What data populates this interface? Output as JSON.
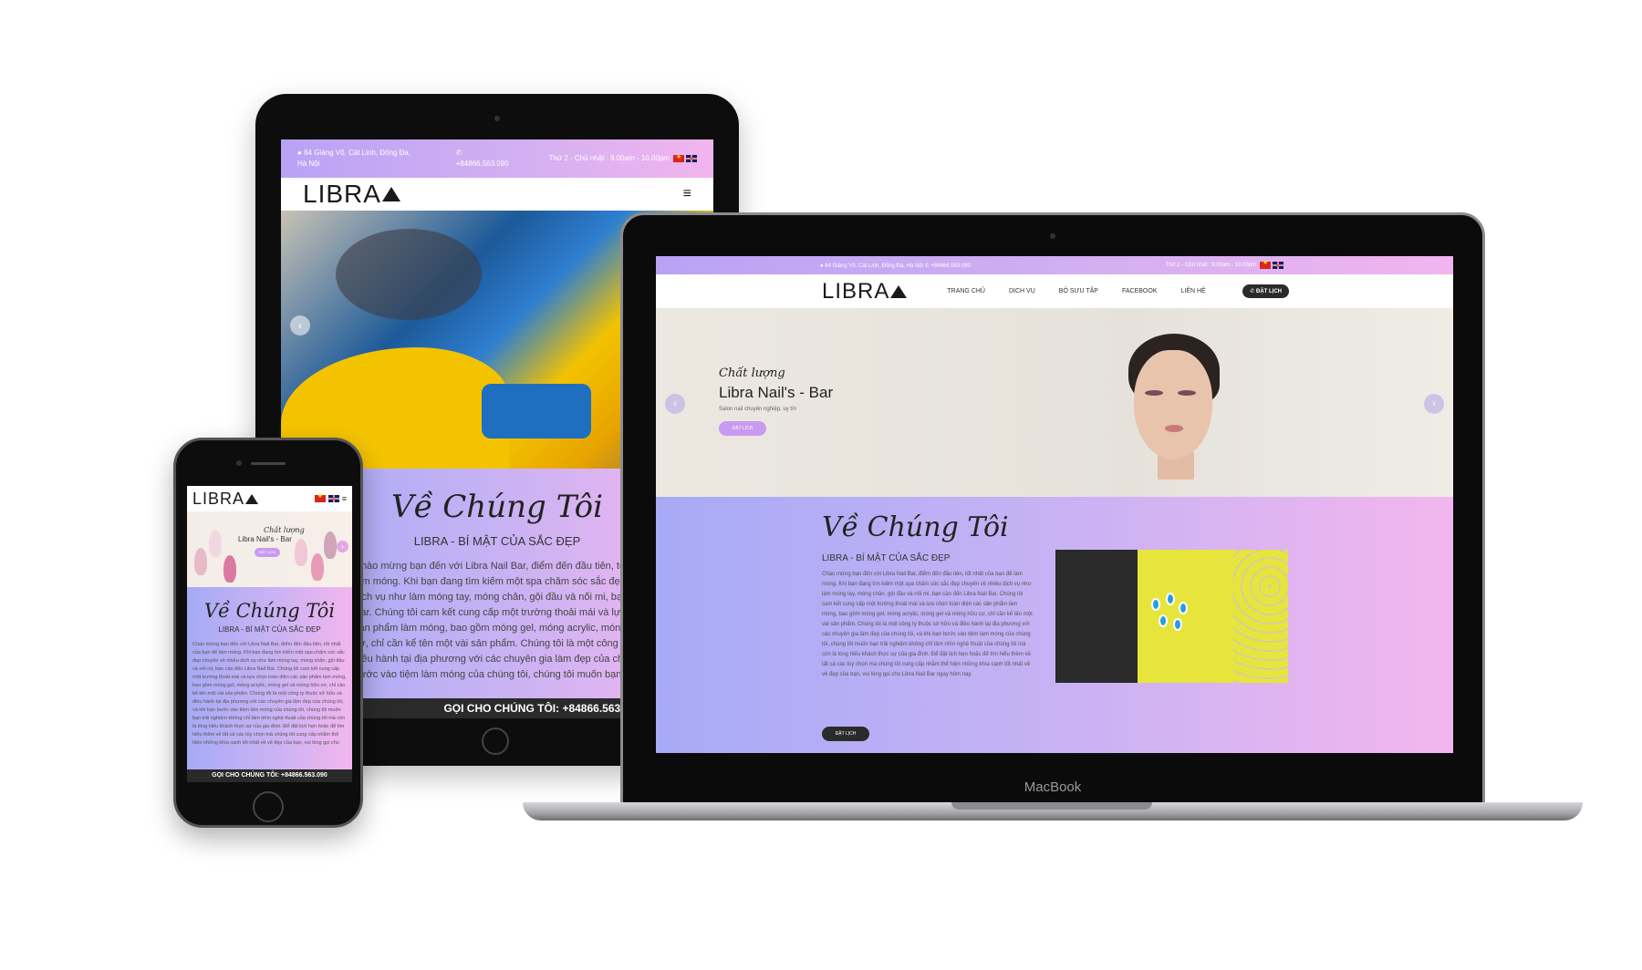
{
  "brand": "LIBRA",
  "topbar": {
    "address": "64 Giảng Võ, Cát Linh, Đống Đa, Hà Nội",
    "phone": "+84866.563.090",
    "hours": "Thứ 2 - Chủ nhật : 9.00am - 10.00pm"
  },
  "nav": {
    "items": [
      "TRANG CHỦ",
      "DỊCH VỤ",
      "BỘ SƯU TẬP",
      "FACEBOOK",
      "LIÊN HỆ"
    ],
    "book_label": "ĐẶT LỊCH"
  },
  "hero": {
    "tag": "Chất lượng",
    "title": "Libra Nail's - Bar",
    "desc": "Salon nail chuyên nghiệp, uy tín",
    "button": "ĐẶT LỊCH"
  },
  "about": {
    "heading": "Về Chúng Tôi",
    "subheading": "LIBRA - BÍ MẬT CỦA SẮC ĐẸP",
    "body": "Chào mừng bạn đến với Libra Nail Bar, điểm đến đầu tiên, tốt nhất của bạn để làm móng. Khi bạn đang tìm kiếm một spa chăm sóc sắc đẹp chuyên về nhiều dịch vụ như làm móng tay, móng chân, gội đầu và nối mi, bạn cần đến Libra Nail Bar. Chúng tôi cam kết cung cấp một trường thoải mái và lựa chọn toàn diện các sản phẩm làm móng, bao gồm móng gel, móng acrylic, móng gel và móng hữu cơ, chỉ cần kể tên một vài sản phẩm. Chúng tôi là một công ty thuộc sở hữu và điều hành tại địa phương với các chuyên gia làm đẹp của chúng tôi, và khi bạn bước vào tiệm làm móng của chúng tôi, chúng tôi muốn bạn trải nghiệm không chỉ tâm nhìn nghệ thuật của chúng tôi mà còn là lòng hiếu khách thực sự của gia đình. Để đặt lịch hẹn hoặc để tìm hiểu thêm về tất cả các tùy chọn mà chúng tôi cung cấp nhằm thể hiện những khía cạnh tốt nhất về vẻ đẹp của bạn, vui lòng gọi cho Libra Nail Bar ngay hôm nay.",
    "button": "ĐẶT LỊCH"
  },
  "call_bar": "GỌI CHO CHÚNG TÔI: +84866.563.090",
  "laptop_brand": "MacBook",
  "icons": {
    "prev": "‹",
    "next": "›",
    "menu": "≡",
    "pin": "●",
    "phone": "✆"
  }
}
